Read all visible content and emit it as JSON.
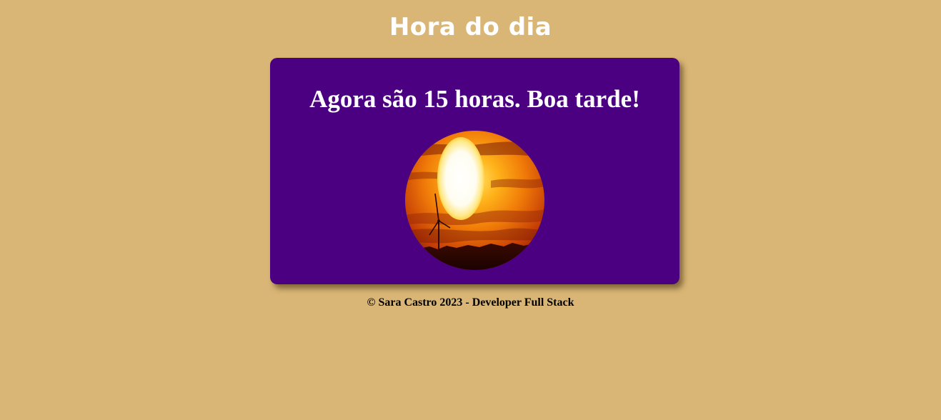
{
  "header": {
    "title": "Hora do dia"
  },
  "card": {
    "message": "Agora são 15 horas. Boa tarde!",
    "image": {
      "subject": "sunset with wind turbine",
      "icon": "sunset-photo"
    }
  },
  "footer": {
    "text": "© Sara Castro 2023 - Developer Full Stack"
  },
  "colors": {
    "page_background": "#d9b676",
    "card_background": "#4b0082",
    "title_text": "#ffffff",
    "footer_text": "#000000"
  }
}
